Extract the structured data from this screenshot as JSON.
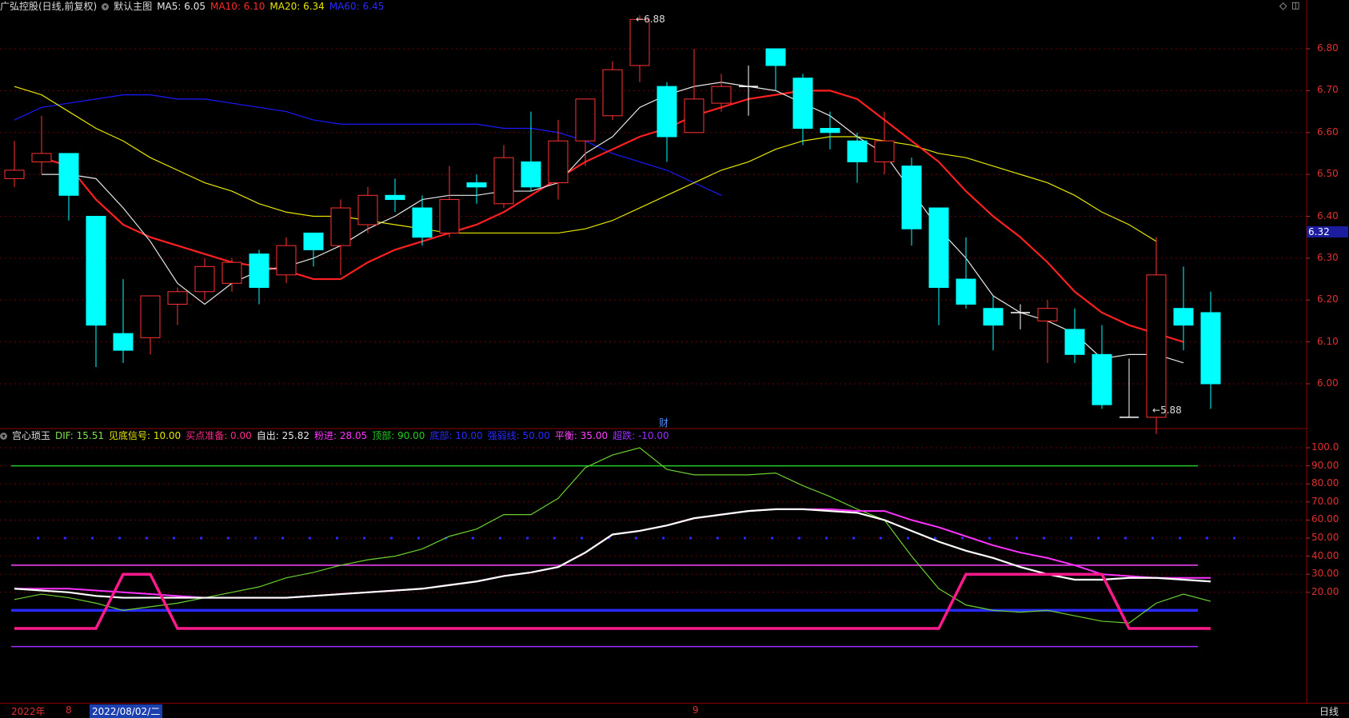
{
  "main_header": {
    "stock": "广弘控股(日线,前复权)",
    "template": "默认主图",
    "ma5": "MA5: 6.05",
    "ma10": "MA10: 6.10",
    "ma20": "MA20: 6.34",
    "ma60": "MA60: 6.45"
  },
  "sub_header": {
    "indicator": "宫心琐玉",
    "dif": "DIF: 15.51",
    "signal": "见底信号: 10.00",
    "buy_ready": "买点准备: 0.00",
    "sell": "自出: 25.82",
    "pink_in": "粉进: 28.05",
    "top": "顶部: 90.00",
    "bottom": "底部: 10.00",
    "strong": "强弱线: 50.00",
    "balance": "平衡: 35.00",
    "oversold": "超跌: -10.00"
  },
  "price_axis": [
    "6.80",
    "6.70",
    "6.60",
    "6.50",
    "6.40",
    "6.30",
    "6.20",
    "6.10",
    "6.00"
  ],
  "current_price": "6.32",
  "sub_axis": [
    "100.0",
    "90.00",
    "80.00",
    "70.00",
    "60.00",
    "50.00",
    "40.00",
    "30.00",
    "20.00"
  ],
  "high_tag": "6.88",
  "low_tag": "5.88",
  "finance_marker": "财",
  "timeline": {
    "year": "2022年",
    "month8": "8",
    "selected_date": "2022/08/02/二",
    "month9": "9",
    "period": "日线"
  },
  "colors": {
    "up": "#ff3232",
    "down": "#00ffff",
    "ma5": "#e6e6e6",
    "ma10": "#ff2020",
    "ma20": "#e6e600",
    "ma60": "#1a1aff"
  },
  "chart_data": [
    {
      "type": "candlestick",
      "ylim": [
        5.85,
        6.9
      ],
      "candles": [
        {
          "o": 6.49,
          "h": 6.58,
          "l": 6.47,
          "c": 6.51
        },
        {
          "o": 6.53,
          "h": 6.64,
          "l": 6.5,
          "c": 6.55
        },
        {
          "o": 6.55,
          "h": 6.55,
          "l": 6.39,
          "c": 6.45
        },
        {
          "o": 6.4,
          "h": 6.4,
          "l": 6.04,
          "c": 6.14
        },
        {
          "o": 6.12,
          "h": 6.25,
          "l": 6.05,
          "c": 6.08
        },
        {
          "o": 6.11,
          "h": 6.21,
          "l": 6.07,
          "c": 6.21
        },
        {
          "o": 6.19,
          "h": 6.23,
          "l": 6.14,
          "c": 6.22
        },
        {
          "o": 6.22,
          "h": 6.3,
          "l": 6.2,
          "c": 6.28
        },
        {
          "o": 6.24,
          "h": 6.3,
          "l": 6.22,
          "c": 6.29
        },
        {
          "o": 6.31,
          "h": 6.32,
          "l": 6.19,
          "c": 6.23
        },
        {
          "o": 6.26,
          "h": 6.35,
          "l": 6.24,
          "c": 6.33
        },
        {
          "o": 6.36,
          "h": 6.36,
          "l": 6.28,
          "c": 6.32
        },
        {
          "o": 6.33,
          "h": 6.44,
          "l": 6.26,
          "c": 6.42
        },
        {
          "o": 6.38,
          "h": 6.47,
          "l": 6.36,
          "c": 6.45
        },
        {
          "o": 6.45,
          "h": 6.49,
          "l": 6.41,
          "c": 6.44
        },
        {
          "o": 6.42,
          "h": 6.45,
          "l": 6.33,
          "c": 6.35
        },
        {
          "o": 6.36,
          "h": 6.52,
          "l": 6.35,
          "c": 6.44
        },
        {
          "o": 6.48,
          "h": 6.5,
          "l": 6.43,
          "c": 6.47
        },
        {
          "o": 6.43,
          "h": 6.57,
          "l": 6.42,
          "c": 6.54
        },
        {
          "o": 6.53,
          "h": 6.65,
          "l": 6.46,
          "c": 6.47
        },
        {
          "o": 6.48,
          "h": 6.63,
          "l": 6.44,
          "c": 6.58
        },
        {
          "o": 6.58,
          "h": 6.68,
          "l": 6.52,
          "c": 6.68
        },
        {
          "o": 6.64,
          "h": 6.77,
          "l": 6.63,
          "c": 6.75
        },
        {
          "o": 6.76,
          "h": 6.88,
          "l": 6.72,
          "c": 6.87
        },
        {
          "o": 6.71,
          "h": 6.72,
          "l": 6.53,
          "c": 6.59
        },
        {
          "o": 6.6,
          "h": 6.8,
          "l": 6.6,
          "c": 6.68
        },
        {
          "o": 6.67,
          "h": 6.74,
          "l": 6.65,
          "c": 6.71
        },
        {
          "o": 6.71,
          "h": 6.76,
          "l": 6.64,
          "c": 6.71
        },
        {
          "o": 6.8,
          "h": 6.8,
          "l": 6.7,
          "c": 6.76
        },
        {
          "o": 6.73,
          "h": 6.74,
          "l": 6.57,
          "c": 6.61
        },
        {
          "o": 6.61,
          "h": 6.65,
          "l": 6.56,
          "c": 6.6
        },
        {
          "o": 6.58,
          "h": 6.6,
          "l": 6.48,
          "c": 6.53
        },
        {
          "o": 6.53,
          "h": 6.65,
          "l": 6.5,
          "c": 6.58
        },
        {
          "o": 6.52,
          "h": 6.54,
          "l": 6.33,
          "c": 6.37
        },
        {
          "o": 6.42,
          "h": 6.42,
          "l": 6.14,
          "c": 6.23
        },
        {
          "o": 6.25,
          "h": 6.35,
          "l": 6.18,
          "c": 6.19
        },
        {
          "o": 6.18,
          "h": 6.21,
          "l": 6.08,
          "c": 6.14
        },
        {
          "o": 6.17,
          "h": 6.19,
          "l": 6.13,
          "c": 6.17
        },
        {
          "o": 6.15,
          "h": 6.2,
          "l": 6.05,
          "c": 6.18
        },
        {
          "o": 6.13,
          "h": 6.18,
          "l": 6.05,
          "c": 6.07
        },
        {
          "o": 6.07,
          "h": 6.14,
          "l": 5.94,
          "c": 5.95
        },
        {
          "o": 5.92,
          "h": 6.06,
          "l": 5.92,
          "c": 5.92
        },
        {
          "o": 5.92,
          "h": 6.35,
          "l": 5.88,
          "c": 6.26
        },
        {
          "o": 6.18,
          "h": 6.28,
          "l": 6.08,
          "c": 6.14
        },
        {
          "o": 6.17,
          "h": 6.22,
          "l": 5.94,
          "c": 6.0
        }
      ],
      "ma5": [
        6.5,
        6.5,
        6.49,
        6.42,
        6.34,
        6.24,
        6.19,
        6.24,
        6.27,
        6.28,
        6.3,
        6.33,
        6.37,
        6.4,
        6.44,
        6.45,
        6.45,
        6.46,
        6.46,
        6.48,
        6.55,
        6.59,
        6.66,
        6.69,
        6.71,
        6.72,
        6.71,
        6.7,
        6.67,
        6.64,
        6.59,
        6.55,
        6.46,
        6.37,
        6.3,
        6.21,
        6.17,
        6.15,
        6.12,
        6.06,
        6.07,
        6.07,
        6.05
      ],
      "ma10": [
        6.54,
        6.52,
        6.44,
        6.38,
        6.35,
        6.33,
        6.31,
        6.29,
        6.28,
        6.27,
        6.25,
        6.25,
        6.29,
        6.32,
        6.34,
        6.36,
        6.38,
        6.41,
        6.45,
        6.49,
        6.53,
        6.56,
        6.59,
        6.61,
        6.64,
        6.66,
        6.68,
        6.69,
        6.7,
        6.7,
        6.68,
        6.63,
        6.58,
        6.53,
        6.46,
        6.4,
        6.35,
        6.29,
        6.22,
        6.17,
        6.14,
        6.12,
        6.1
      ],
      "ma20": [
        6.71,
        6.69,
        6.65,
        6.61,
        6.58,
        6.54,
        6.51,
        6.48,
        6.46,
        6.43,
        6.41,
        6.4,
        6.4,
        6.39,
        6.38,
        6.37,
        6.36,
        6.36,
        6.36,
        6.36,
        6.36,
        6.37,
        6.39,
        6.42,
        6.45,
        6.48,
        6.51,
        6.53,
        6.56,
        6.58,
        6.59,
        6.59,
        6.58,
        6.57,
        6.55,
        6.54,
        6.52,
        6.5,
        6.48,
        6.45,
        6.41,
        6.38,
        6.34
      ],
      "ma60": [
        6.63,
        6.66,
        6.67,
        6.68,
        6.69,
        6.69,
        6.68,
        6.68,
        6.67,
        6.66,
        6.65,
        6.63,
        6.62,
        6.62,
        6.62,
        6.62,
        6.62,
        6.62,
        6.61,
        6.61,
        6.6,
        6.58,
        6.55,
        6.53,
        6.51,
        6.48,
        6.45
      ]
    },
    {
      "type": "line",
      "ylim": [
        -12,
        102
      ],
      "series": [
        {
          "name": "DIF",
          "values": [
            16,
            19,
            17,
            14,
            10,
            12,
            14,
            17,
            20,
            23,
            28,
            31,
            35,
            38,
            40,
            44,
            51,
            55,
            63,
            63,
            72,
            89,
            96,
            100,
            88,
            85,
            85,
            85,
            86,
            79,
            73,
            66,
            60,
            40,
            22,
            13,
            10,
            9,
            10,
            7,
            4,
            3,
            14,
            19,
            15
          ]
        },
        {
          "name": "粉进",
          "values": [
            22,
            22,
            22,
            21,
            20,
            19,
            18,
            17,
            17,
            17,
            17,
            18,
            19,
            20,
            21,
            22,
            24,
            26,
            29,
            31,
            34,
            42,
            52,
            54,
            57,
            61,
            63,
            65,
            66,
            66,
            66,
            65,
            65,
            60,
            56,
            51,
            46,
            42,
            39,
            35,
            30,
            29,
            28,
            28,
            28
          ]
        },
        {
          "name": "自出",
          "values": [
            22,
            21,
            20,
            18,
            17,
            17,
            17,
            17,
            17,
            17,
            17,
            18,
            19,
            20,
            21,
            22,
            24,
            26,
            29,
            31,
            34,
            42,
            52,
            54,
            57,
            61,
            63,
            65,
            66,
            66,
            65,
            64,
            60,
            54,
            48,
            43,
            39,
            34,
            30,
            27,
            27,
            28,
            28,
            27,
            26
          ]
        },
        {
          "name": "买点准备",
          "values": [
            0,
            0,
            0,
            0,
            30,
            30,
            0,
            0,
            0,
            0,
            0,
            0,
            0,
            0,
            0,
            0,
            0,
            0,
            0,
            0,
            0,
            0,
            0,
            0,
            0,
            0,
            0,
            0,
            0,
            0,
            0,
            0,
            0,
            0,
            0,
            30,
            30,
            30,
            30,
            30,
            30,
            0,
            0,
            0,
            0
          ]
        }
      ]
    }
  ]
}
